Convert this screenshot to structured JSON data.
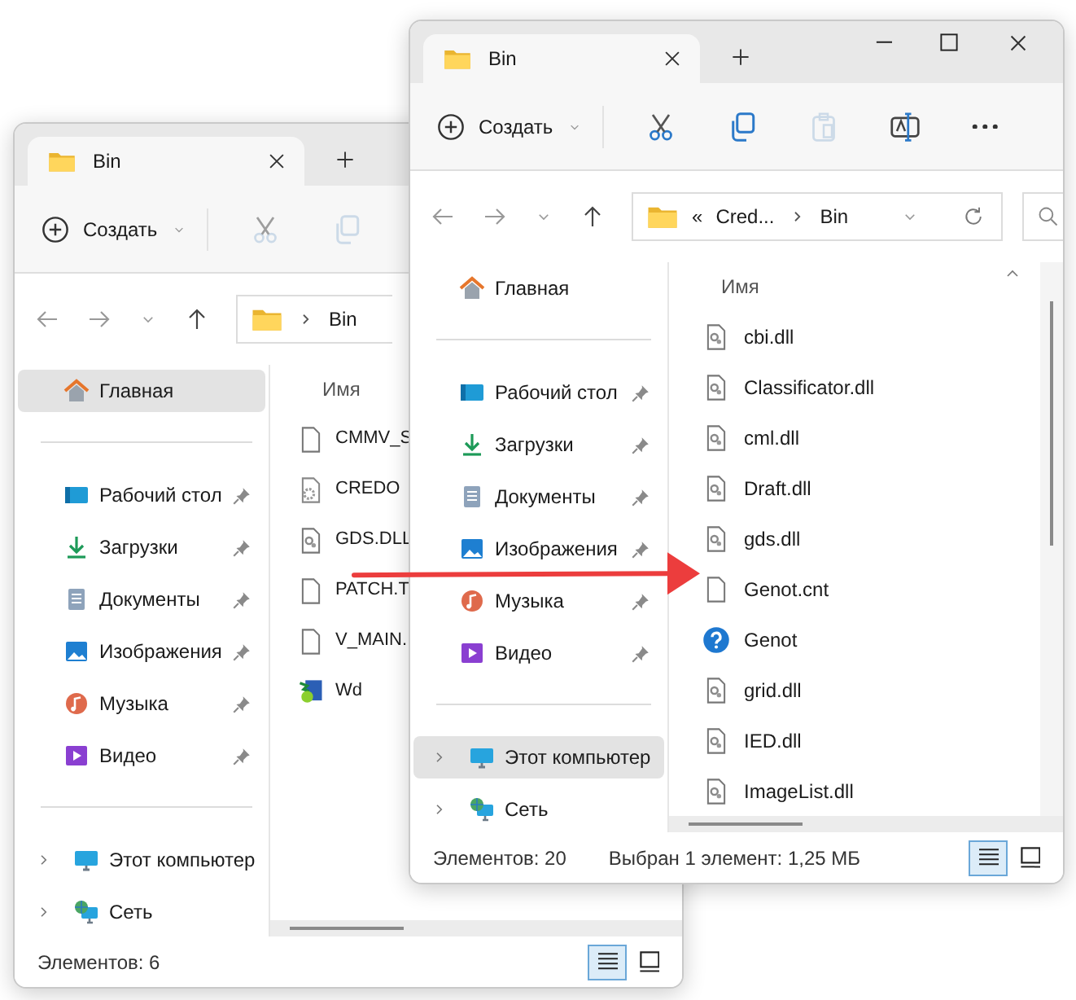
{
  "back_window": {
    "tab": {
      "title": "Bin"
    },
    "toolbar": {
      "new_label": "Создать",
      "actions": [
        {
          "kind": "cut",
          "disabled": true
        },
        {
          "kind": "copy",
          "disabled": true
        }
      ]
    },
    "address": {
      "path": [
        "Bin"
      ]
    },
    "sidebar": [
      {
        "label": "Главная",
        "kind": "home",
        "selected": true,
        "pinned": false
      },
      {
        "kind": "divider"
      },
      {
        "label": "Рабочий стол",
        "kind": "desktop",
        "selected": false,
        "pinned": true
      },
      {
        "label": "Загрузки",
        "kind": "downloads",
        "selected": false,
        "pinned": true
      },
      {
        "label": "Документы",
        "kind": "documents",
        "selected": false,
        "pinned": true
      },
      {
        "label": "Изображения",
        "kind": "pictures",
        "selected": false,
        "pinned": true
      },
      {
        "label": "Музыка",
        "kind": "music",
        "selected": false,
        "pinned": true
      },
      {
        "label": "Видео",
        "kind": "video",
        "selected": false,
        "pinned": true
      },
      {
        "kind": "divider"
      },
      {
        "label": "Этот компьютер",
        "kind": "computer",
        "selected": false,
        "pinned": false,
        "expandable": true
      },
      {
        "label": "Сеть",
        "kind": "network",
        "selected": false,
        "pinned": false,
        "expandable": true
      }
    ],
    "files": {
      "column": "Имя",
      "rows": [
        {
          "name": "CMMV_S",
          "kind": "file"
        },
        {
          "name": "CREDO",
          "kind": "config"
        },
        {
          "name": "GDS.DLL",
          "kind": "dll"
        },
        {
          "name": "PATCH.T",
          "kind": "file"
        },
        {
          "name": "V_MAIN.",
          "kind": "file"
        },
        {
          "name": "Wd",
          "kind": "app"
        }
      ]
    },
    "status_bar": {
      "count": "Элементов: 6"
    },
    "view": [
      {
        "kind": "details",
        "selected": true
      },
      {
        "kind": "tiles",
        "selected": false
      }
    ]
  },
  "front_window": {
    "tab": {
      "title": "Bin"
    },
    "toolbar": {
      "new_label": "Создать",
      "actions": [
        {
          "kind": "cut",
          "disabled": false
        },
        {
          "kind": "copy",
          "disabled": false
        },
        {
          "kind": "paste",
          "disabled": true
        },
        {
          "kind": "rename",
          "disabled": false
        },
        {
          "kind": "more",
          "disabled": false
        }
      ]
    },
    "address": {
      "overflow_mark": "«",
      "path": [
        "Cred...",
        "Bin"
      ]
    },
    "sidebar": [
      {
        "label": "Главная",
        "kind": "home",
        "selected": false,
        "pinned": false
      },
      {
        "kind": "divider"
      },
      {
        "label": "Рабочий стол",
        "kind": "desktop",
        "selected": false,
        "pinned": true
      },
      {
        "label": "Загрузки",
        "kind": "downloads",
        "selected": false,
        "pinned": true
      },
      {
        "label": "Документы",
        "kind": "documents",
        "selected": false,
        "pinned": true
      },
      {
        "label": "Изображения",
        "kind": "pictures",
        "selected": false,
        "pinned": true
      },
      {
        "label": "Музыка",
        "kind": "music",
        "selected": false,
        "pinned": true
      },
      {
        "label": "Видео",
        "kind": "video",
        "selected": false,
        "pinned": true
      },
      {
        "kind": "divider"
      },
      {
        "label": "Этот компьютер",
        "kind": "computer",
        "selected": true,
        "pinned": false,
        "expandable": true
      },
      {
        "label": "Сеть",
        "kind": "network",
        "selected": false,
        "pinned": false,
        "expandable": true
      }
    ],
    "files": {
      "column": "Имя",
      "rows": [
        {
          "name": "cbi.dll",
          "kind": "dll"
        },
        {
          "name": "Classificator.dll",
          "kind": "dll"
        },
        {
          "name": "cml.dll",
          "kind": "dll"
        },
        {
          "name": "Draft.dll",
          "kind": "dll"
        },
        {
          "name": "gds.dll",
          "kind": "dll"
        },
        {
          "name": "Genot.cnt",
          "kind": "file"
        },
        {
          "name": "Genot",
          "kind": "help"
        },
        {
          "name": "grid.dll",
          "kind": "dll"
        },
        {
          "name": "IED.dll",
          "kind": "dll"
        },
        {
          "name": "ImageList.dll",
          "kind": "dll"
        }
      ]
    },
    "status_bar": {
      "count": "Элементов: 20",
      "selection": "Выбран 1 элемент: 1,25 МБ"
    },
    "view": [
      {
        "kind": "details",
        "selected": true
      },
      {
        "kind": "tiles",
        "selected": false
      }
    ]
  }
}
